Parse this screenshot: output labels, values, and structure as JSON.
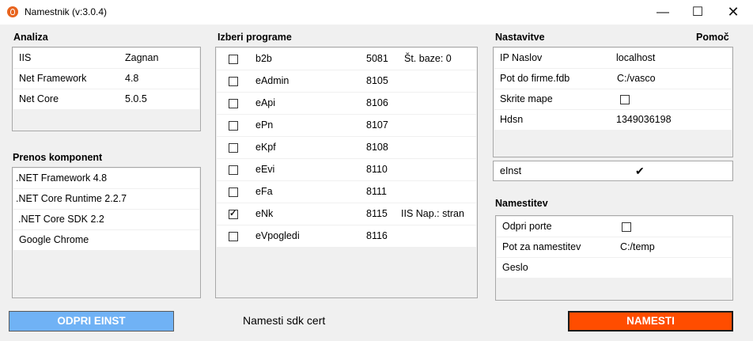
{
  "window": {
    "title": "Namestnik (v:3.0.4)",
    "min": "—",
    "max": "☐",
    "close": "✕"
  },
  "analiza": {
    "title": "Analiza",
    "rows": [
      {
        "name": "IIS",
        "value": "Zagnan"
      },
      {
        "name": "Net Framework",
        "value": "4.8"
      },
      {
        "name": "Net Core",
        "value": "5.0.5"
      }
    ]
  },
  "prenos": {
    "title": "Prenos komponent",
    "items": [
      ".NET Framework 4.8",
      ".NET Core Runtime 2.2.7",
      ".NET Core SDK 2.2",
      "Google Chrome"
    ]
  },
  "programi": {
    "title": "Izberi programe",
    "rows": [
      {
        "checked": false,
        "name": "b2b",
        "port": "5081",
        "note": "Št. baze: 0"
      },
      {
        "checked": false,
        "name": "eAdmin",
        "port": "8105",
        "note": ""
      },
      {
        "checked": false,
        "name": "eApi",
        "port": "8106",
        "note": ""
      },
      {
        "checked": false,
        "name": "ePn",
        "port": "8107",
        "note": ""
      },
      {
        "checked": false,
        "name": "eKpf",
        "port": "8108",
        "note": ""
      },
      {
        "checked": false,
        "name": "eEvi",
        "port": "8110",
        "note": ""
      },
      {
        "checked": false,
        "name": "eFa",
        "port": "8111",
        "note": ""
      },
      {
        "checked": true,
        "name": "eNk",
        "port": "8115",
        "note": "IIS Nap.: stran"
      },
      {
        "checked": false,
        "name": "eVpogledi",
        "port": "8116",
        "note": ""
      }
    ]
  },
  "nastavitve": {
    "title": "Nastavitve",
    "help": "Pomoč",
    "rows": [
      {
        "name": "IP Naslov",
        "value": "localhost",
        "type": "text"
      },
      {
        "name": "Pot do firme.fdb",
        "value": "C:/vasco",
        "type": "text"
      },
      {
        "name": "Skrite mape",
        "value": "",
        "type": "checkbox",
        "checked": false
      },
      {
        "name": "Hdsn",
        "value": "1349036198",
        "type": "text"
      }
    ],
    "einst": {
      "name": "eInst",
      "mark": "✔"
    }
  },
  "namestitev": {
    "title": "Namestitev",
    "rows": [
      {
        "name": "Odpri porte",
        "value": "",
        "type": "checkbox",
        "checked": false
      },
      {
        "name": "Pot za namestitev",
        "value": "C:/temp",
        "type": "text"
      },
      {
        "name": "Geslo",
        "value": "",
        "type": "text"
      }
    ]
  },
  "footer": {
    "open_button": "ODPRI EINST",
    "status": "Namesti sdk cert",
    "install_button": "NAMESTI"
  },
  "colors": {
    "blue_button": "#70b2f5",
    "orange_button": "#ff4d00"
  }
}
